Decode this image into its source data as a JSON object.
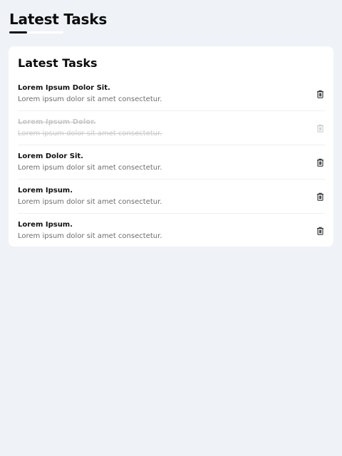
{
  "header": {
    "title": "Latest Tasks"
  },
  "card": {
    "title": "Latest Tasks",
    "tasks": [
      {
        "title": "Lorem Ipsum Dolor Sit.",
        "description": "Lorem ipsum dolor sit amet consectetur.",
        "completed": false,
        "action_icon": "trash-icon"
      },
      {
        "title": "Lorem Ipsum Dolor.",
        "description": "Lorem ipsum dolor sit amet consectetur.",
        "completed": true,
        "action_icon": "trash-icon"
      },
      {
        "title": "Lorem Dolor Sit.",
        "description": "Lorem ipsum dolor sit amet consectetur.",
        "completed": false,
        "action_icon": "trash-icon"
      },
      {
        "title": "Lorem Ipsum.",
        "description": "Lorem ipsum dolor sit amet consectetur.",
        "completed": false,
        "action_icon": "trash-icon"
      },
      {
        "title": "Lorem Ipsum.",
        "description": "Lorem ipsum dolor sit amet consectetur.",
        "completed": false,
        "action_icon": "trash-icon"
      }
    ]
  },
  "colors": {
    "background": "#eff3f8",
    "card": "#ffffff",
    "text": "#111111",
    "muted": "#6d6d6d",
    "completed": "#c9c9c9"
  }
}
